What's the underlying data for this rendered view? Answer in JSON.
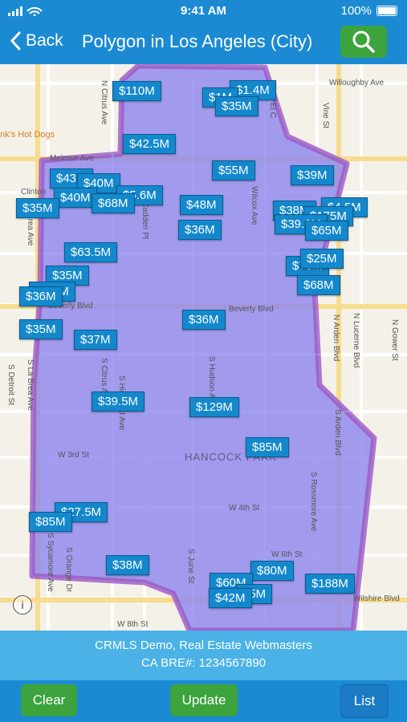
{
  "status_bar": {
    "time": "9:41 AM",
    "battery": "100%"
  },
  "nav": {
    "back_label": "Back",
    "title": "Polygon in Los Angeles (City)"
  },
  "map": {
    "area_label": "HANCOCK PARK",
    "poi": "nk's Hot Dogs",
    "streets": {
      "willoughby": "Willoughby Ave",
      "melrose": "Melrose Ave",
      "clinton": "Clinton",
      "beverly_left": "Beverly Blvd",
      "beverly_mid": "Beverly Blvd",
      "third": "W 3rd St",
      "fourth": "W 4th St",
      "sixth": "W 6th St",
      "wilshire": "Wilshire Blvd",
      "eighth": "W 8th St",
      "citrus": "N Citrus Ave",
      "mccadden": "McCadden Pl",
      "wilcox": "Wilcox Ave",
      "vine": "Vine St",
      "el_centro": "El C",
      "la_brea_n": "La Brea Ave",
      "la_brea_s": "S La Brea Ave",
      "detroit": "S Detroit St",
      "citrus_s": "S Citrus Ave",
      "highland": "S Highland Ave",
      "hudson": "S Hudson Ave",
      "sycamore": "S Sycamore Ave",
      "orange": "S Orange Dr",
      "june": "S June St",
      "rossmore": "S Rossmore Ave",
      "arden_s": "S Arden Blvd",
      "arden_n": "N Arden Blvd",
      "lucerne": "N Lucerne Blvd",
      "gower": "N Gower St"
    },
    "pins": [
      "$110M",
      "$1.4M",
      "$1M",
      "$35M",
      "$42.5M",
      "$55M",
      "$39M",
      "$43M",
      "$40M",
      "$40M",
      "$5.6M",
      "$68M",
      "$48M",
      "$35M",
      "$36M",
      "$38M",
      "$4.5M",
      "$175M",
      "$39.6M",
      "$65M",
      "$63.5M",
      "$70M",
      "$25M",
      "$68M",
      "$35M",
      "$2.1M",
      "$36M",
      "$36M",
      "$35M",
      "$37M",
      "$39.5M",
      "$129M",
      "$85M",
      "$27.5M",
      "$85M",
      "$38M",
      "$80M",
      "$60M",
      "$5M",
      "$42M",
      "$188M"
    ]
  },
  "footer": {
    "line1": "CRMLS Demo, Real Estate Webmasters",
    "line2": "CA BRE#: 1234567890"
  },
  "toolbar": {
    "clear": "Clear",
    "update": "Update",
    "list": "List"
  },
  "colors": {
    "nav_bg": "#1b8ad3",
    "footer_bg": "#4ab2e6",
    "button_green": "#3ca33d",
    "polygon_fill": "#8f86ee",
    "pin_bg": "#1488cc"
  }
}
